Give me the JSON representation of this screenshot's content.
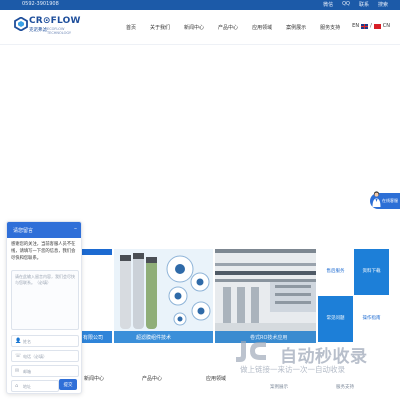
{
  "topbar": {
    "phone": "0592-3901908",
    "links": [
      "微信",
      "QQ",
      "联系",
      "搜索"
    ]
  },
  "header": {
    "logo_name": "CR⊙FLOW",
    "logo_cn": "克诺弗滤",
    "logo_en": "ECOFLOW TECHNOLOGY",
    "nav": [
      "首页",
      "关于我们",
      "新闻中心",
      "产品中心",
      "应用领域",
      "案例展示",
      "服务支持"
    ],
    "lang_en": "EN",
    "lang_sep": "/",
    "lang_cn": "CN"
  },
  "float_service": {
    "label": "在线客服"
  },
  "cards": {
    "card1_caption": "有限公司",
    "card2_caption": "超滤膜组件技术",
    "card3_caption": "卷式RO技术应用"
  },
  "tiles": [
    "售后服务",
    "资料下载",
    "常见问题",
    "操作指南"
  ],
  "footer": {
    "columns": [
      "新闻中心",
      "产品中心",
      "应用领域"
    ],
    "subs": [
      "案例展示",
      "服务支持"
    ]
  },
  "chat": {
    "title": "请您留言",
    "message": "感谢您的关注，当前客服人员不在线，请填写一下您的信息，我们会尽快和您联系。",
    "textarea_placeholder": "请在此输入留言内容，我们会尽快与您联系。（必填）",
    "fields": [
      {
        "icon": "user-icon",
        "placeholder": "姓名"
      },
      {
        "icon": "phone-icon",
        "placeholder": "电话（必填）"
      },
      {
        "icon": "mail-icon",
        "placeholder": "邮箱"
      },
      {
        "icon": "location-icon",
        "placeholder": "地址"
      }
    ],
    "send": "提交"
  },
  "watermark": {
    "big": "自动秒收录",
    "small": "做上链接一来访一次一自动收录"
  },
  "colors": {
    "brand_blue": "#1c5aa8",
    "accent_blue": "#2f6fd8",
    "tile_blue": "#1d7fd8"
  }
}
